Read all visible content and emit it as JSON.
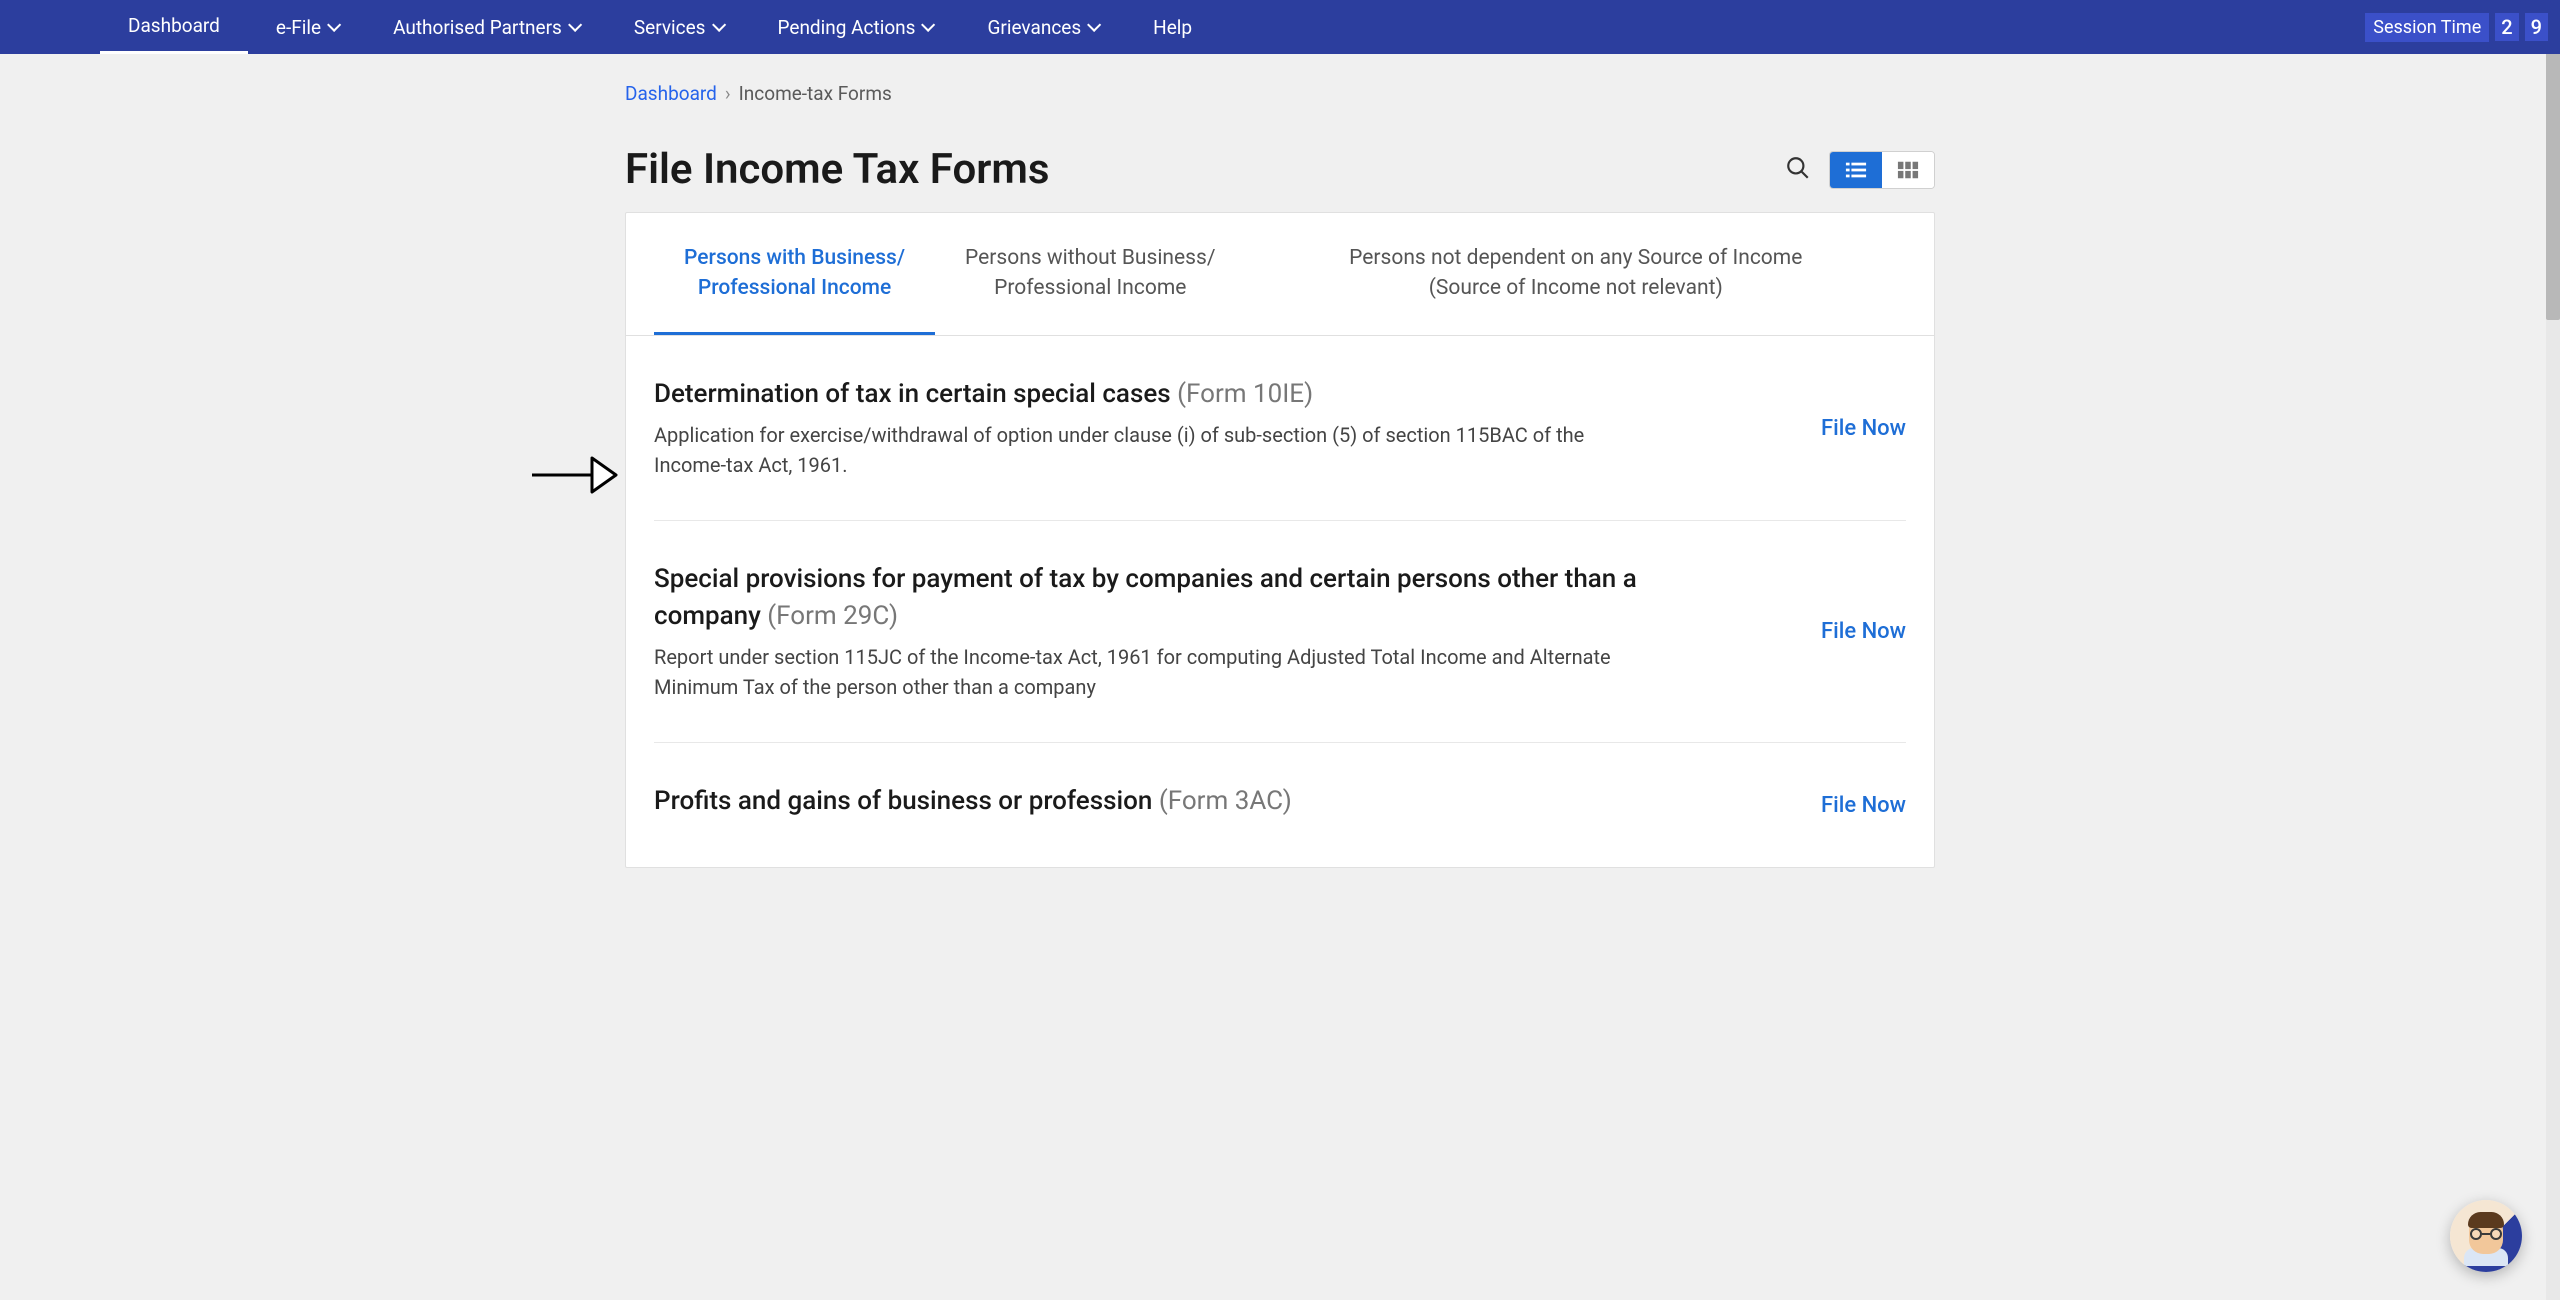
{
  "nav": {
    "items": [
      {
        "label": "Dashboard",
        "dropdown": false,
        "active": true
      },
      {
        "label": "e-File",
        "dropdown": true
      },
      {
        "label": "Authorised Partners",
        "dropdown": true
      },
      {
        "label": "Services",
        "dropdown": true
      },
      {
        "label": "Pending Actions",
        "dropdown": true
      },
      {
        "label": "Grievances",
        "dropdown": true
      },
      {
        "label": "Help",
        "dropdown": false
      }
    ],
    "session_label": "Session Time",
    "session_d1": "2",
    "session_d2": "9"
  },
  "breadcrumb": {
    "root": "Dashboard",
    "current": "Income-tax Forms"
  },
  "page_title": "File Income Tax Forms",
  "tabs": [
    {
      "line1": "Persons with Business/",
      "line2": "Professional Income",
      "active": true
    },
    {
      "line1": "Persons without Business/",
      "line2": "Professional Income",
      "active": false
    },
    {
      "line1": "Persons not dependent on any Source of Income",
      "line2": "(Source of Income not relevant)",
      "active": false
    }
  ],
  "forms": [
    {
      "title": "Determination of tax in certain special cases",
      "code": "(Form 10IE)",
      "desc": "Application for exercise/withdrawal of option under clause (i) of sub-section (5) of section 115BAC of the Income-tax Act, 1961.",
      "action": "File Now"
    },
    {
      "title": "Special provisions for payment of tax by companies and certain persons other than a company",
      "code": "(Form 29C)",
      "desc": "Report under section 115JC of the Income-tax Act, 1961 for computing Adjusted Total Income and Alternate Minimum Tax of the person other than a company",
      "action": "File Now"
    },
    {
      "title": "Profits and gains of business or profession",
      "code": "(Form 3AC)",
      "desc": "",
      "action": "File Now"
    }
  ]
}
